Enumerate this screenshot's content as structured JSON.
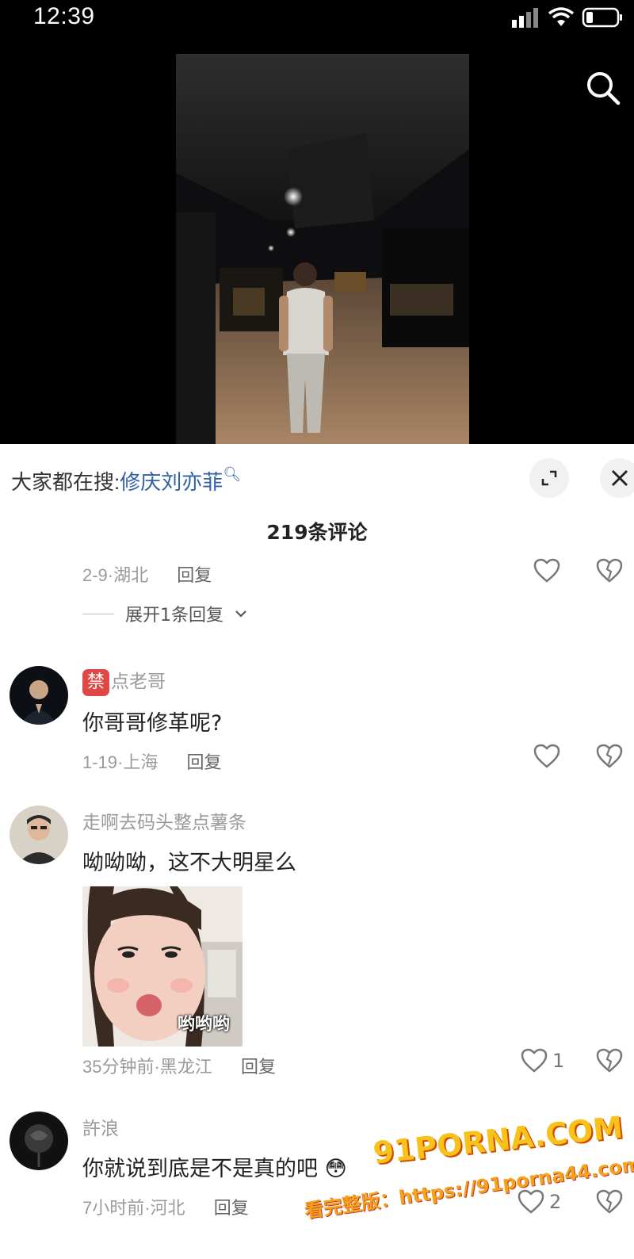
{
  "status_bar": {
    "time": "12:39"
  },
  "search_bar": {
    "prefix": "大家都在搜:",
    "term": "修庆刘亦菲"
  },
  "comments_header": {
    "title": "219条评论"
  },
  "partial_comment": {
    "date_location": "2-9·湖北",
    "reply_label": "回复"
  },
  "expand_replies": {
    "label": "展开1条回复"
  },
  "comments": [
    {
      "badge": "禁",
      "username": "点老哥",
      "text": "你哥哥修革呢?",
      "date_location": "1-19·上海",
      "reply_label": "回复",
      "like_count": ""
    },
    {
      "username": "走啊去码头整点薯条",
      "text": "呦呦呦，这不大明星么",
      "sticker_caption": "哟哟哟",
      "date_location": "35分钟前·黑龙江",
      "reply_label": "回复",
      "like_count": "1"
    },
    {
      "username": "許浪",
      "text": "你就说到底是不是真的吧",
      "date_location": "7小时前·河北",
      "reply_label": "回复",
      "like_count": "2"
    }
  ],
  "watermark": {
    "brand": "91PORNA.COM",
    "line": "看完整版：https://91porna44.com"
  }
}
